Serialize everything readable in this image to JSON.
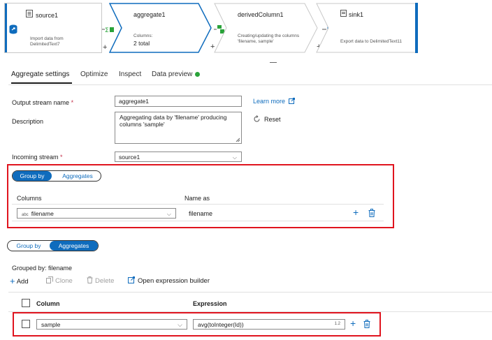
{
  "pipeline": {
    "nodes": [
      {
        "title": "source1",
        "sub": "Import data from DelimitedText7",
        "sub_lines": [
          "Import data from",
          "DelimitedText7"
        ]
      },
      {
        "title": "aggregate1",
        "sub": "Columns:",
        "value": "2 total"
      },
      {
        "title": "derivedColumn1",
        "sub_lines": [
          "Creating/updating the columns",
          "'filename, sample'"
        ]
      },
      {
        "title": "sink1",
        "sub": "Export data to DelimitedText11"
      }
    ]
  },
  "tabs": {
    "aggregate_settings": "Aggregate settings",
    "optimize": "Optimize",
    "inspect": "Inspect",
    "data_preview": "Data preview"
  },
  "form": {
    "output_stream_name_label": "Output stream name",
    "output_stream_name_value": "aggregate1",
    "learn_more": "Learn more",
    "description_label": "Description",
    "description_lines": [
      "Aggregating data by 'filename' producing",
      "columns 'sample'"
    ],
    "reset": "Reset",
    "incoming_stream_label": "Incoming stream",
    "incoming_stream_value": "source1",
    "required_marker": "*"
  },
  "groupby_section": {
    "toggle_group_by": "Group by",
    "toggle_aggregates": "Aggregates",
    "columns_header": "Columns",
    "name_as_header": "Name as",
    "row": {
      "type_tag": "abc",
      "column": "filename",
      "name_as": "filename"
    }
  },
  "aggregates_section": {
    "toggle_group_by": "Group by",
    "toggle_aggregates": "Aggregates",
    "grouped_by": "Grouped by: filename",
    "toolbar": {
      "add": "Add",
      "clone": "Clone",
      "delete": "Delete",
      "open_expression_builder": "Open expression builder"
    },
    "column_header": "Column",
    "expression_header": "Expression",
    "row": {
      "column": "sample",
      "expression": "avg(toInteger(Id))",
      "type_badge": "1.2"
    }
  },
  "colors": {
    "accent": "#0f6cbd",
    "highlight": "#e0141e",
    "status_green": "#2aa33a",
    "required": "#c4314b"
  }
}
